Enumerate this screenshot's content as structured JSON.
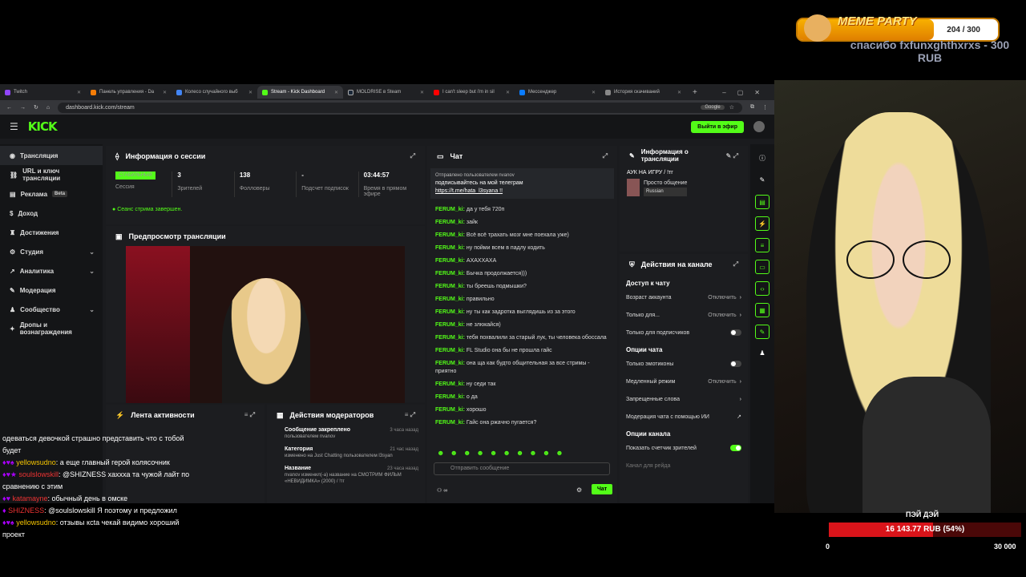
{
  "tabs": [
    "Twitch",
    "Панель управления - Da",
    "Колесо случайного выб",
    "Stream - Kick Dashboard",
    "MOLDRISE в Steam",
    "I can't sleep but i'm in sil",
    "Мессенджер",
    "История скачиваний"
  ],
  "url": "dashboard.kick.com/stream",
  "google": "Google",
  "logo": "KICK",
  "go_live": "Выйти в эфир",
  "sidebar": [
    "Трансляция",
    "URL и ключ трансляции",
    "Реклама",
    "Доход",
    "Достижения",
    "Студия",
    "Аналитика",
    "Модерация",
    "Сообщество",
    "Дропы и вознаграждения"
  ],
  "beta": "Beta",
  "session": {
    "title": "Информация о сессии",
    "badge": "СТАБИЛЬНЫЙ",
    "stats": [
      {
        "v": "",
        "l": "Сессия"
      },
      {
        "v": "3",
        "l": "Зрителей"
      },
      {
        "v": "138",
        "l": "Фолловеры"
      },
      {
        "v": "-",
        "l": "Подсчет подписок"
      },
      {
        "v": "03:44:57",
        "l": "Время в прямом эфире"
      }
    ],
    "ended": "Сеанс стрима завершен."
  },
  "preview_title": "Предпросмотр трансляции",
  "activity": "Лента активности",
  "modactions": {
    "title": "Действия модераторов",
    "items": [
      {
        "a": "Сообщение закреплено",
        "b": "пользователем nvanov",
        "t": "3 часа назад"
      },
      {
        "a": "Категория",
        "b": "изменено на Just Chatting пользователем l3syan",
        "t": "21 час назад"
      },
      {
        "a": "Название",
        "b": "nvanov изменил(-а) название на СМОТРИМ ФИЛЬМ «НЕВИДИМКА» (2000) / !тг",
        "t": "23 часа назад"
      }
    ]
  },
  "chat": {
    "title": "Чат",
    "pinned_by": "Отправлено пользователем nvanov",
    "pinned": "подписывайтесь на мой телеграм",
    "link": "https://t.me/hata_l3syana !!",
    "messages": [
      [
        "FERUM_ki:",
        "да у тебя 720п"
      ],
      [
        "FERUM_ki:",
        "зайк"
      ],
      [
        "FERUM_ki:",
        "Всё всё трахать мозг мне поехала уже)"
      ],
      [
        "FERUM_ki:",
        "ну пойми всем в падлу кодить"
      ],
      [
        "FERUM_ki:",
        "АХАХХАХА"
      ],
      [
        "FERUM_ki:",
        "Бычка продолжается)))"
      ],
      [
        "FERUM_ki:",
        "ты бреешь подмышки?"
      ],
      [
        "FERUM_ki:",
        "правильно"
      ],
      [
        "FERUM_ki:",
        "ну ты как задротка выглядишь из за этого"
      ],
      [
        "FERUM_ki:",
        "не злюкайся)"
      ],
      [
        "FERUM_ki:",
        "тебя похвалили за старый лук, ты человека обоссала"
      ],
      [
        "FERUM_ki:",
        "FL Studio она бы не прошла гайс"
      ],
      [
        "FERUM_ki:",
        "она ща как будто общительная за все стримы - приятно"
      ],
      [
        "FERUM_ki:",
        "ну седи так"
      ],
      [
        "FERUM_ki:",
        "о да"
      ],
      [
        "FERUM_ki:",
        "хорошо"
      ],
      [
        "FERUM_ki:",
        "Гайс она ржачно пугается?"
      ]
    ],
    "placeholder": "Отправить сообщение",
    "send": "Чат"
  },
  "stream_info": {
    "title": "Информация о трансляции",
    "name": "АУК НА ИГРУ / !тг",
    "category": "Просто общение",
    "lang": "Russian"
  },
  "channel": {
    "title": "Действия на канале",
    "access": "Доступ к чату",
    "rows": [
      [
        "Возраст аккаунта",
        "Отключить"
      ],
      [
        "Только для...",
        "Отключить"
      ],
      [
        "Только для подписчиков",
        ""
      ]
    ],
    "chat_opts": "Опции чата",
    "rows2": [
      [
        "Только эмотиконы",
        ""
      ],
      [
        "Медленный режим",
        "Отключить"
      ],
      [
        "Запрещенные слова",
        ""
      ],
      [
        "Модерация чата с помощью ИИ",
        ""
      ]
    ],
    "ch_opts": "Опции канала",
    "show_count": "Показать счетчик зрителей",
    "raid": "Канал для рейда"
  },
  "overlay": [
    {
      "n": "",
      "m": "одеваться девочкой страшно представить что с тобой будет"
    },
    {
      "n": "yellowsudno",
      "m": ": а еще главный герой колясочник"
    },
    {
      "n": "soulslowskill",
      "m": ": @SHIZNESS хаххха та чужой лайт по сравнению с этим"
    },
    {
      "n": "katamayne",
      "m": ": обычный день в омске"
    },
    {
      "n": "SHIZNESS",
      "m": ": @soulslowskill Я поэтому и предложил"
    },
    {
      "n": "yellowsudno",
      "m": ": отзывы ксta чекай видимо хороший проект"
    }
  ],
  "meme": {
    "title": "MEME PARTY",
    "count": "204 / 300",
    "progress": 0.68,
    "thanks": "спасибо fxfunxghthxrxs - 300 RUB"
  },
  "donation": {
    "name": "ПЭЙ ДЭЙ",
    "amount": "16 143.77 RUB (54%)",
    "min": "0",
    "max": "30 000",
    "progress": 0.54
  }
}
